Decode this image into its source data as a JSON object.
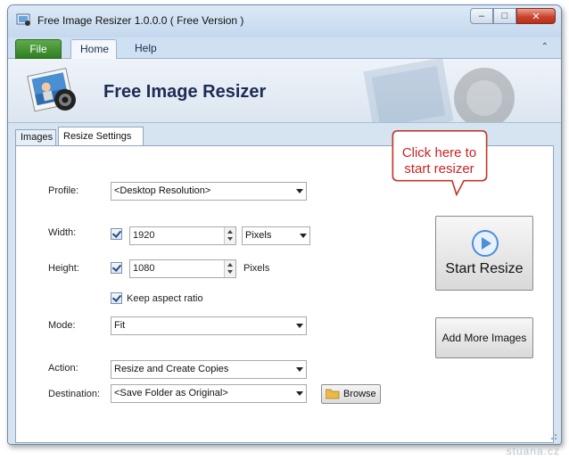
{
  "window": {
    "title": "Free Image Resizer 1.0.0.0 ( Free Version )"
  },
  "ribbon": {
    "tabs": [
      "File",
      "Home",
      "Help"
    ],
    "active_tab": "Home",
    "banner_title": "Free Image Resizer"
  },
  "content_tabs": [
    "Images",
    "Resize Settings"
  ],
  "active_content_tab": "Resize Settings",
  "form": {
    "profile_label": "Profile:",
    "profile_value": "<Desktop Resolution>",
    "width_label": "Width:",
    "width_checked": true,
    "width_value": "1920",
    "width_unit": "Pixels",
    "height_label": "Height:",
    "height_checked": true,
    "height_value": "1080",
    "height_unit": "Pixels",
    "keep_aspect_label": "Keep aspect ratio",
    "keep_aspect_checked": true,
    "mode_label": "Mode:",
    "mode_value": "Fit",
    "action_label": "Action:",
    "action_value": "Resize and Create Copies",
    "destination_label": "Destination:",
    "destination_value": "<Save Folder as Original>",
    "browse_label": "Browse"
  },
  "buttons": {
    "start_resize": "Start Resize",
    "add_more_images": "Add More Images"
  },
  "callout": {
    "text_line1": "Click here to",
    "text_line2": "start resizer"
  },
  "watermark": "stuana.cz",
  "colors": {
    "file_tab": "#3a8a2c",
    "callout_border": "#c0392b",
    "callout_text": "#cc2222",
    "banner_title": "#1e2c55",
    "play_icon": "#4a8fd8"
  }
}
